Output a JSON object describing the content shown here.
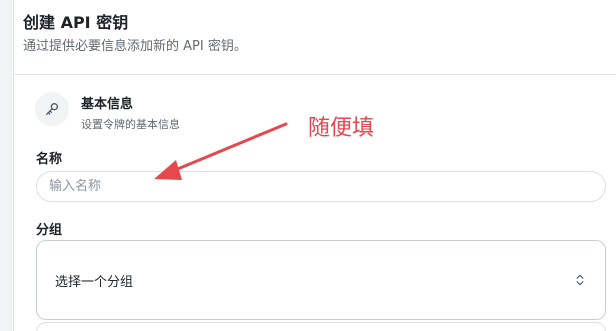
{
  "dialog": {
    "title": "创建 API 密钥",
    "subtitle": "通过提供必要信息添加新的 API 密钥。"
  },
  "section": {
    "icon": "key-icon",
    "title": "基本信息",
    "description": "设置令牌的基本信息"
  },
  "name_field": {
    "label": "名称",
    "placeholder": "输入名称",
    "value": ""
  },
  "group_field": {
    "label": "分组",
    "placeholder": "选择一个分组",
    "icon": "chevron-updown-icon"
  },
  "annotation": {
    "text": "随便填",
    "color": "#e5484d"
  }
}
